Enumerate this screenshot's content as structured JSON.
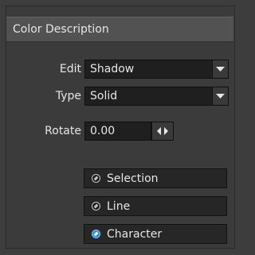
{
  "panel": {
    "title": "Color Description"
  },
  "fields": {
    "edit": {
      "label": "Edit",
      "value": "Shadow"
    },
    "type": {
      "label": "Type",
      "value": "Solid"
    },
    "rotate": {
      "label": "Rotate",
      "value": "0.00"
    }
  },
  "selection_buttons": [
    {
      "label": "Selection",
      "selected": false
    },
    {
      "label": "Line",
      "selected": false
    },
    {
      "label": "Character",
      "selected": true
    }
  ],
  "colors": {
    "accent": "#2b8fd6",
    "background": "#3d3d3d",
    "header": "#525252"
  },
  "icons": {
    "dropdown": "triangle-down-icon",
    "spinner": "left-right-arrows-icon",
    "radio": "radio-dot-icon"
  }
}
